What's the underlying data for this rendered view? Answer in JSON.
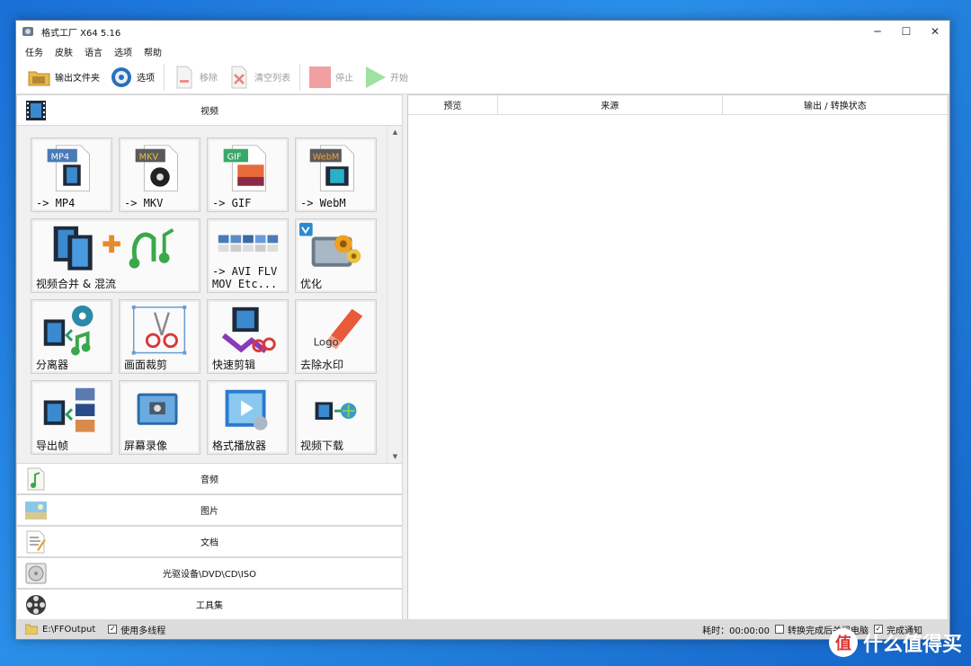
{
  "window": {
    "title": "格式工厂 X64 5.16"
  },
  "window_controls": {
    "minimize": "─",
    "maximize": "☐",
    "close": "✕"
  },
  "menu": [
    "任务",
    "皮肤",
    "语言",
    "选项",
    "帮助"
  ],
  "toolbar": {
    "output_folder": "输出文件夹",
    "options": "选项",
    "remove": "移除",
    "clear_list": "清空列表",
    "stop": "停止",
    "start": "开始"
  },
  "categories": {
    "video": "视频",
    "audio": "音频",
    "image": "图片",
    "document": "文档",
    "optical": "光驱设备\\DVD\\CD\\ISO",
    "tools": "工具集"
  },
  "tiles": {
    "mp4": {
      "label": "-> MP4",
      "badge": "MP4"
    },
    "mkv": {
      "label": "-> MKV",
      "badge": "MKV"
    },
    "gif": {
      "label": "-> GIF",
      "badge": "GIF"
    },
    "webm": {
      "label": "-> WebM",
      "badge": "WebM"
    },
    "merge": {
      "label": "视频合并 & 混流"
    },
    "avi": {
      "label": "-> AVI FLV\nMOV Etc..."
    },
    "optimize": {
      "label": "优化"
    },
    "splitter": {
      "label": "分离器"
    },
    "crop": {
      "label": "画面裁剪"
    },
    "quick_cut": {
      "label": "快速剪辑"
    },
    "watermark": {
      "label": "去除水印",
      "art_text": "Logo"
    },
    "export_frames": {
      "label": "导出帧"
    },
    "screen_record": {
      "label": "屏幕录像"
    },
    "player": {
      "label": "格式播放器"
    },
    "download": {
      "label": "视频下载"
    }
  },
  "table": {
    "columns": [
      "预览",
      "来源",
      "输出 / 转换状态"
    ]
  },
  "status": {
    "output_path": "E:\\FFOutput",
    "multithread_label": "使用多线程",
    "multithread_checked": true,
    "elapsed": "耗时：00:00:00",
    "shutdown_label": "转换完成后关闭电脑",
    "shutdown_checked": false,
    "notify_label": "完成通知",
    "notify_checked": true
  },
  "overlay": {
    "watermark_text": "什么值得买",
    "watermark_logo": "值"
  }
}
